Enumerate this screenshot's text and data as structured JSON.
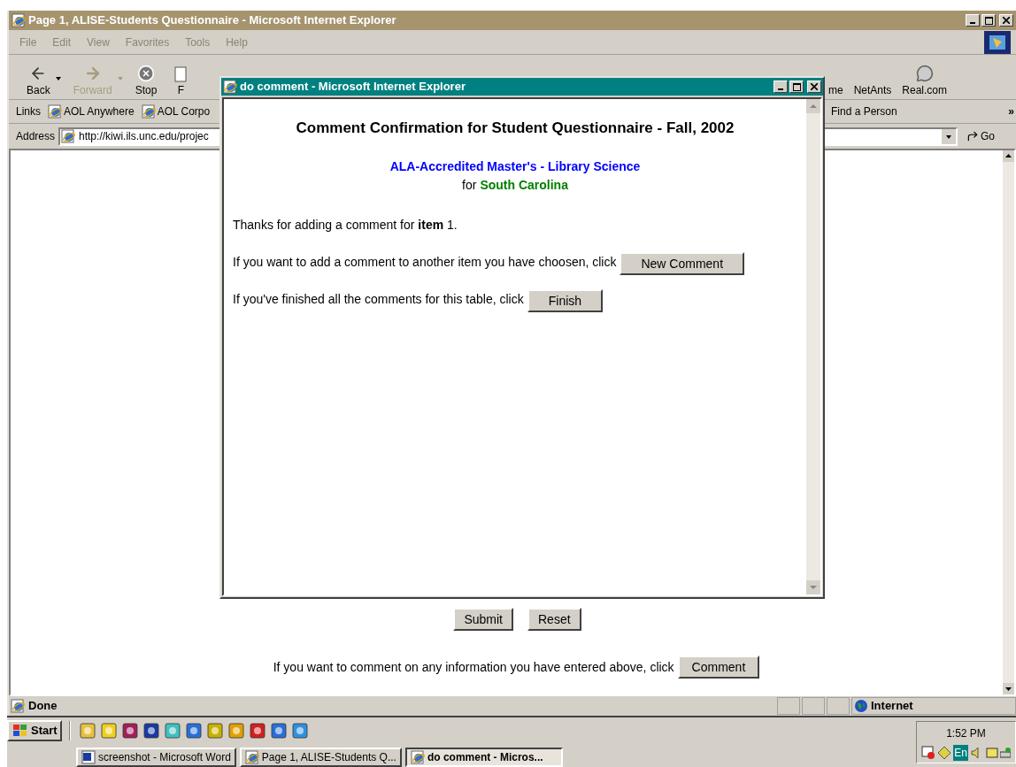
{
  "main_window": {
    "title": "Page 1, ALISE-Students Questionnaire - Microsoft Internet Explorer",
    "menu": [
      "File",
      "Edit",
      "View",
      "Favorites",
      "Tools",
      "Help"
    ],
    "toolbar_left": [
      {
        "kind": "back",
        "label": "Back",
        "disabled": false
      },
      {
        "kind": "forward",
        "label": "Forward",
        "disabled": true
      },
      {
        "kind": "stop",
        "label": "Stop",
        "disabled": false
      },
      {
        "kind": "refresh",
        "label": "F",
        "disabled": false
      }
    ],
    "toolbar_right": [
      {
        "kind": "plain",
        "label": "me",
        "disabled": false
      },
      {
        "kind": "plain",
        "label": "NetAnts",
        "disabled": false
      },
      {
        "kind": "bubble",
        "label": "Real.com",
        "disabled": false
      }
    ],
    "links_label": "Links",
    "links": [
      "AOL Anywhere",
      "AOL Corpo"
    ],
    "links_right": [
      "Find a Person"
    ],
    "links_more": "»",
    "address_label": "Address",
    "address": "http://kiwi.ils.unc.edu/projec",
    "go": "Go",
    "page": {
      "buttons": [
        "Submit",
        "Reset"
      ],
      "comment_prompt": "If you want to comment on any information you have entered above, click",
      "comment_button": "Comment"
    },
    "status": "Done",
    "zone": "Internet"
  },
  "popup": {
    "title": "do comment - Microsoft Internet Explorer",
    "heading": "Comment Confirmation for Student Questionnaire - Fall, 2002",
    "program": "ALA-Accredited Master's - Library Science",
    "for_label": "for",
    "state": "South Carolina",
    "thanks": "Thanks for adding a comment for **item** 1.",
    "rows": [
      {
        "text": "If you want to add a comment to another item you have choosen, click",
        "button": "New Comment"
      },
      {
        "text": "If you've finished all the comments for this table, click",
        "button": "Finish"
      }
    ]
  },
  "taskbar": {
    "start": "Start",
    "tasks": [
      {
        "label": "screenshot - Microsoft Word",
        "kind": "word",
        "selected": false
      },
      {
        "label": "Page 1, ALISE-Students Q...",
        "kind": "ie",
        "selected": false
      },
      {
        "label": "do comment - Micros...",
        "kind": "ie",
        "selected": true
      }
    ],
    "clock": "1:52 PM",
    "language": "En"
  }
}
